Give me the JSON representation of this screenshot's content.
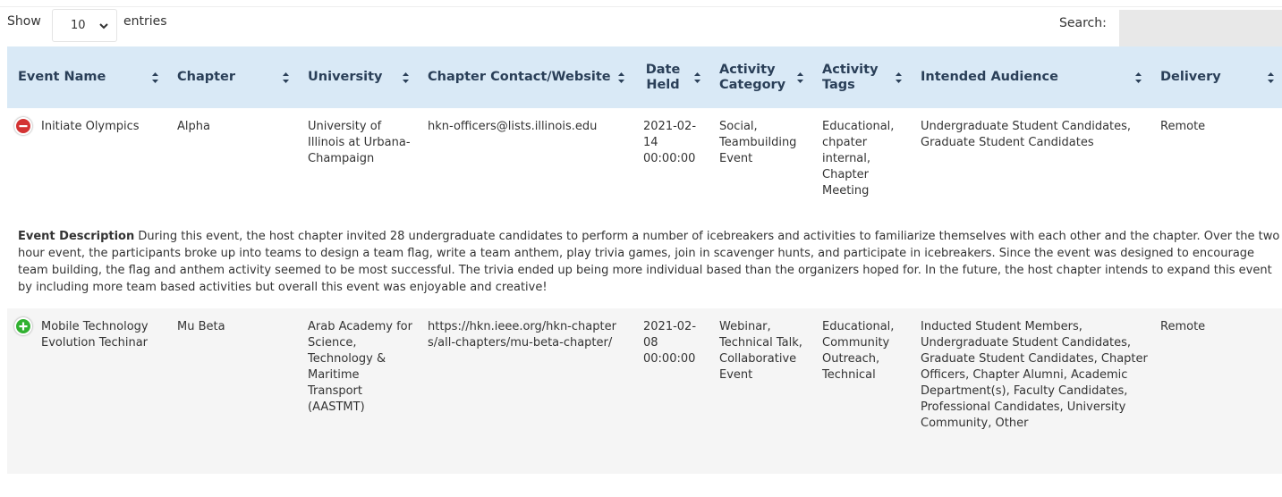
{
  "controls": {
    "show_label": "Show",
    "length_value": "10",
    "entries_label": "entries",
    "search_label": "Search:",
    "search_value": ""
  },
  "columns": [
    "Event Name",
    "Chapter",
    "University",
    "Chapter Contact/Website",
    "Date Held",
    "Activity Category",
    "Activity Tags",
    "Intended Audience",
    "Delivery"
  ],
  "rows": [
    {
      "expanded": true,
      "event_name": "Initiate Olympics",
      "chapter": "Alpha",
      "university": "University of Illinois at Urbana-Champaign",
      "contact": "hkn-officers@lists.illinois.edu",
      "date_held": "2021-02-14 00:00:00",
      "category": "Social, Teambuilding Event",
      "tags": "Educational, chpater internal, Chapter Meeting",
      "audience": "Undergraduate Student Candidates, Graduate Student Candidates",
      "delivery": "Remote",
      "detail_label": "Event Description",
      "detail_text": "During this event, the host chapter invited 28 undergraduate candidates to perform a number of icebreakers and activities to familiarize themselves with each other and the chapter. Over the two hour event, the participants broke up into teams to design a team flag, write a team anthem, play trivia games, join in scavenger hunts, and participate in icebreakers. Since the event was designed to encourage team building, the flag and anthem activity seemed to be most successful. The trivia ended up being more individual based than the organizers hoped for. In the future, the host chapter intends to expand this event by including more team based activities but overall this event was enjoyable and creative!"
    },
    {
      "expanded": false,
      "event_name": "Mobile Technology Evolution Techinar",
      "chapter": "Mu Beta",
      "university": "Arab Academy for Science, Technology & Maritime Transport (AASTMT)",
      "contact": "https://hkn.ieee.org/hkn-chapters/all-chapters/mu-beta-chapter/",
      "date_held": "2021-02-08 00:00:00",
      "category": "Webinar, Technical Talk, Collaborative Event",
      "tags": "Educational, Community Outreach, Technical",
      "audience": "Inducted Student Members, Undergraduate Student Candidates, Graduate Student Candidates, Chapter Officers, Chapter Alumni, Academic Department(s), Faculty Candidates, Professional Candidates, University Community, Other",
      "delivery": "Remote"
    }
  ],
  "icons": {
    "collapse": "minus-circle-icon",
    "expand": "plus-circle-icon",
    "sort": "sort-both-icon",
    "select": "chevron-down-icon"
  },
  "colors": {
    "header_bg": "#d9e9f6",
    "header_text": "#2a3f58",
    "collapse_red": "#d33333",
    "expand_green": "#31b131",
    "search_bg": "#e8e8e8"
  }
}
